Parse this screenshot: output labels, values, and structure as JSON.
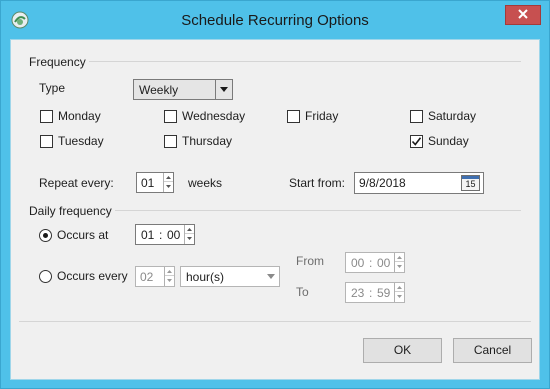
{
  "window": {
    "title": "Schedule Recurring Options"
  },
  "frequency": {
    "group_label": "Frequency",
    "type_label": "Type",
    "type_value": "Weekly",
    "days": [
      {
        "label": "Monday",
        "checked": false
      },
      {
        "label": "Wednesday",
        "checked": false
      },
      {
        "label": "Friday",
        "checked": false
      },
      {
        "label": "Saturday",
        "checked": false
      },
      {
        "label": "Tuesday",
        "checked": false
      },
      {
        "label": "Thursday",
        "checked": false
      },
      {
        "label": "Sunday",
        "checked": true
      }
    ],
    "repeat_label": "Repeat every:",
    "repeat_value": "01",
    "repeat_unit": "weeks",
    "start_label": "Start from:",
    "start_value": "9/8/2018",
    "calendar_day": "15"
  },
  "daily": {
    "group_label": "Daily frequency",
    "occurs_at_label": "Occurs at",
    "occurs_at_selected": true,
    "occurs_at_hour": "01",
    "occurs_at_minute": "00",
    "occurs_every_label": "Occurs every",
    "occurs_every_value": "02",
    "occurs_every_unit": "hour(s)",
    "from_label": "From",
    "from_hour": "00",
    "from_minute": "00",
    "to_label": "To",
    "to_hour": "23",
    "to_minute": "59",
    "time_separator": ":"
  },
  "buttons": {
    "ok": "OK",
    "cancel": "Cancel"
  },
  "colors": {
    "title_bar": "#4fc1e9",
    "close_button": "#c75050",
    "dialog_body": "#f0f0f0"
  }
}
